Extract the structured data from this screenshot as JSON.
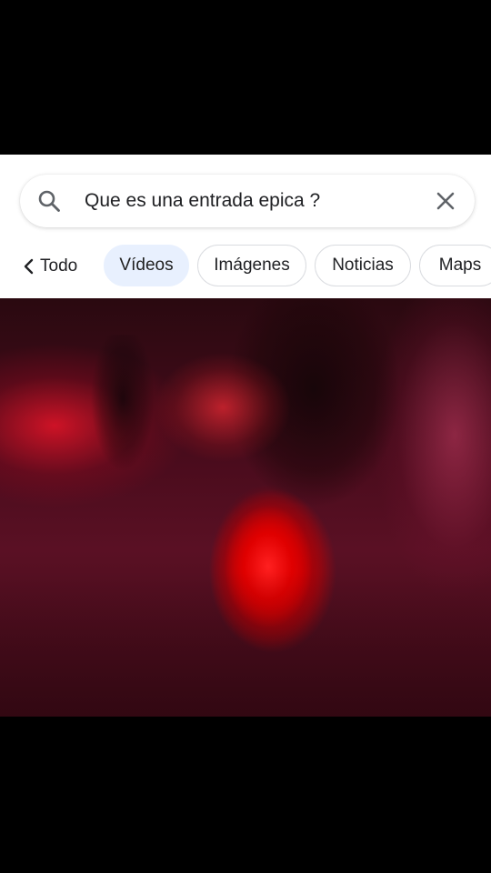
{
  "search": {
    "query": "Que es una entrada epica ?"
  },
  "tabs": {
    "back_label": "Todo",
    "items": [
      {
        "label": "Vídeos",
        "active": true
      },
      {
        "label": "Imágenes",
        "active": false
      },
      {
        "label": "Noticias",
        "active": false
      },
      {
        "label": "Maps",
        "active": false
      }
    ]
  },
  "colors": {
    "active_chip_bg": "#e8f0fe",
    "chip_border": "#dadce0",
    "text": "#202124",
    "icon_gray": "#5f6368",
    "background": "#000000"
  },
  "icons": {
    "search": "search-icon",
    "clear": "close-icon",
    "back": "chevron-left-icon"
  }
}
